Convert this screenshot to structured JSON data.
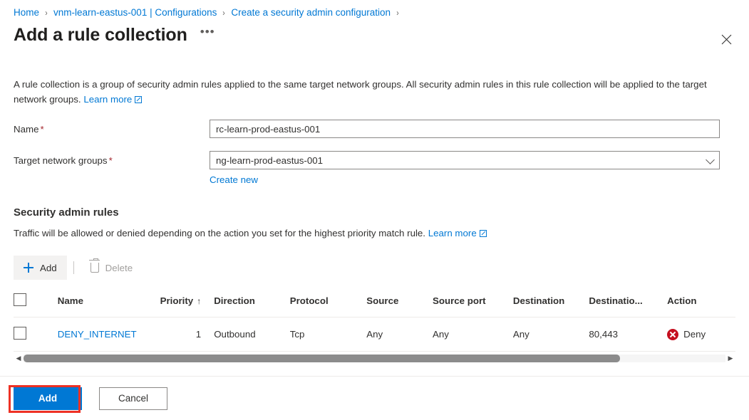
{
  "breadcrumb": {
    "items": [
      {
        "label": "Home"
      },
      {
        "label": "vnm-learn-eastus-001 | Configurations"
      },
      {
        "label": "Create a security admin configuration"
      }
    ],
    "separator": "›"
  },
  "header": {
    "title": "Add a rule collection",
    "ellipsis_label": "•••",
    "close_label": "✕"
  },
  "description": {
    "text": "A rule collection is a group of security admin rules applied to the same target network groups. All security admin rules in this rule collection will be applied to the target network groups.",
    "learn_more": "Learn more"
  },
  "form": {
    "name": {
      "label": "Name",
      "required_marker": "*",
      "value": "rc-learn-prod-eastus-001",
      "placeholder": "Enter a name"
    },
    "target_network_groups": {
      "label": "Target network groups",
      "required_marker": "*",
      "value": "ng-learn-prod-eastus-001",
      "placeholder": "Select network groups",
      "create_new_label": "Create new"
    }
  },
  "rules_section": {
    "heading": "Security admin rules",
    "description": "Traffic will be allowed or denied depending on the action you set for the highest priority match rule.",
    "learn_more": "Learn more",
    "toolbar": {
      "add_label": "Add",
      "delete_label": "Delete"
    },
    "table": {
      "columns": [
        {
          "key": "check",
          "label": ""
        },
        {
          "key": "name",
          "label": "Name"
        },
        {
          "key": "priority",
          "label": "Priority",
          "sort": "↑"
        },
        {
          "key": "direction",
          "label": "Direction"
        },
        {
          "key": "protocol",
          "label": "Protocol"
        },
        {
          "key": "source",
          "label": "Source"
        },
        {
          "key": "source_port",
          "label": "Source port"
        },
        {
          "key": "destination",
          "label": "Destination"
        },
        {
          "key": "destination_port",
          "label": "Destinatio..."
        },
        {
          "key": "action",
          "label": "Action"
        }
      ],
      "rows": [
        {
          "name": "DENY_INTERNET",
          "priority": "1",
          "direction": "Outbound",
          "protocol": "Tcp",
          "source": "Any",
          "source_port": "Any",
          "destination": "Any",
          "destination_port": "80,443",
          "action": "Deny"
        }
      ],
      "scroll": {
        "left_arrow": "◀",
        "right_arrow": "▶"
      }
    }
  },
  "footer": {
    "add_label": "Add",
    "cancel_label": "Cancel"
  },
  "colors": {
    "accent": "#0078d4",
    "link": "#0078d4",
    "required": "#a4262c",
    "deny": "#c50f1f",
    "annotation": "#ee3124"
  }
}
